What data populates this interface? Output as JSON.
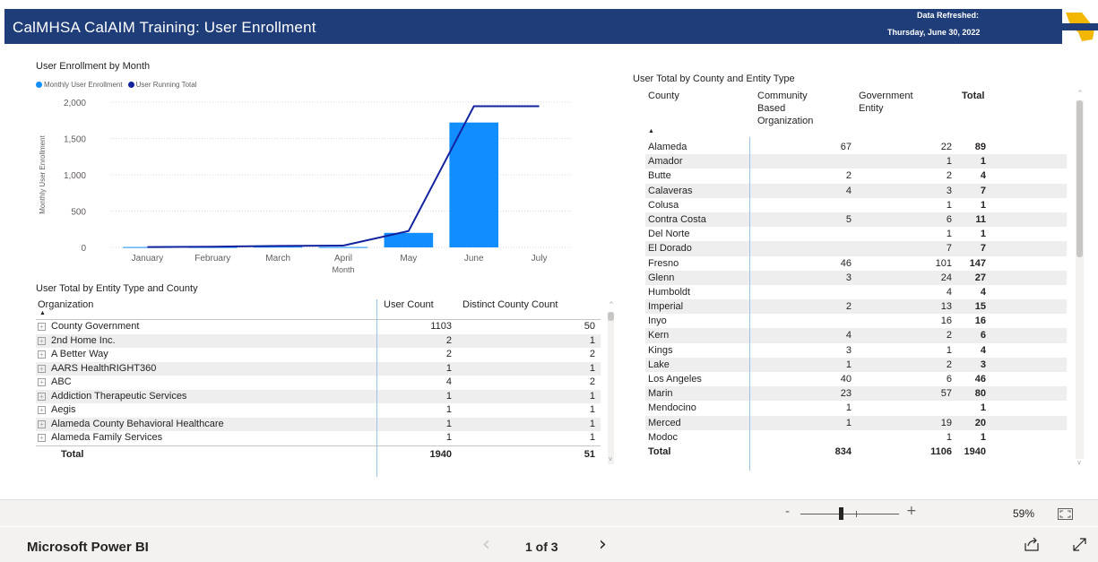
{
  "header": {
    "title": "CalMHSA CalAIM Training: User Enrollment",
    "refresh_label": "Data Refreshed:",
    "refresh_date": "Thursday, June 30, 2022"
  },
  "colors": {
    "header_bg": "#1f3d79",
    "bar": "#118dff",
    "line": "#12239e"
  },
  "chart_title": "User Enrollment by Month",
  "chart_data": {
    "type": "bar",
    "categories": [
      "January",
      "February",
      "March",
      "April",
      "May",
      "June",
      "July"
    ],
    "series": [
      {
        "name": "Monthly User Enrollment",
        "type": "bar",
        "values": [
          5,
          5,
          10,
          5,
          200,
          1720,
          0
        ]
      },
      {
        "name": "User Running Total",
        "type": "line",
        "values": [
          5,
          10,
          20,
          25,
          225,
          1945,
          1945
        ]
      }
    ],
    "xlabel": "Month",
    "ylabel": "Monthly User Enrollment",
    "ylim": [
      0,
      2000
    ],
    "yticks": [
      "0",
      "500",
      "1,000",
      "1,500",
      "2,000"
    ],
    "grid": true,
    "legend_position": "top-left"
  },
  "entity_table": {
    "title": "User Total by Entity Type and County",
    "headers": {
      "org": "Organization",
      "count": "User Count",
      "distinct": "Distinct County Count"
    },
    "rows": [
      {
        "org": "County Government",
        "count": "1103",
        "distinct": "50"
      },
      {
        "org": "2nd Home Inc.",
        "count": "2",
        "distinct": "1"
      },
      {
        "org": "A Better Way",
        "count": "2",
        "distinct": "2"
      },
      {
        "org": "AARS HealthRIGHT360",
        "count": "1",
        "distinct": "1"
      },
      {
        "org": "ABC",
        "count": "4",
        "distinct": "2"
      },
      {
        "org": "Addiction Therapeutic Services",
        "count": "1",
        "distinct": "1"
      },
      {
        "org": "Aegis",
        "count": "1",
        "distinct": "1"
      },
      {
        "org": "Alameda County Behavioral Healthcare",
        "count": "1",
        "distinct": "1"
      },
      {
        "org": "Alameda Family Services",
        "count": "1",
        "distinct": "1"
      }
    ],
    "total": {
      "label": "Total",
      "count": "1940",
      "distinct": "51"
    }
  },
  "county_table": {
    "title": "User Total by County and Entity Type",
    "headers": {
      "county": "County",
      "cbo": "Community\nBased\nOrganization",
      "gov": "Government\nEntity",
      "total": "Total"
    },
    "rows": [
      {
        "county": "Alameda",
        "cbo": "67",
        "gov": "22",
        "total": "89"
      },
      {
        "county": "Amador",
        "cbo": "",
        "gov": "1",
        "total": "1"
      },
      {
        "county": "Butte",
        "cbo": "2",
        "gov": "2",
        "total": "4"
      },
      {
        "county": "Calaveras",
        "cbo": "4",
        "gov": "3",
        "total": "7"
      },
      {
        "county": "Colusa",
        "cbo": "",
        "gov": "1",
        "total": "1"
      },
      {
        "county": "Contra Costa",
        "cbo": "5",
        "gov": "6",
        "total": "11"
      },
      {
        "county": "Del Norte",
        "cbo": "",
        "gov": "1",
        "total": "1"
      },
      {
        "county": "El Dorado",
        "cbo": "",
        "gov": "7",
        "total": "7"
      },
      {
        "county": "Fresno",
        "cbo": "46",
        "gov": "101",
        "total": "147"
      },
      {
        "county": "Glenn",
        "cbo": "3",
        "gov": "24",
        "total": "27"
      },
      {
        "county": "Humboldt",
        "cbo": "",
        "gov": "4",
        "total": "4"
      },
      {
        "county": "Imperial",
        "cbo": "2",
        "gov": "13",
        "total": "15"
      },
      {
        "county": "Inyo",
        "cbo": "",
        "gov": "16",
        "total": "16"
      },
      {
        "county": "Kern",
        "cbo": "4",
        "gov": "2",
        "total": "6"
      },
      {
        "county": "Kings",
        "cbo": "3",
        "gov": "1",
        "total": "4"
      },
      {
        "county": "Lake",
        "cbo": "1",
        "gov": "2",
        "total": "3"
      },
      {
        "county": "Los Angeles",
        "cbo": "40",
        "gov": "6",
        "total": "46"
      },
      {
        "county": "Marin",
        "cbo": "23",
        "gov": "57",
        "total": "80"
      },
      {
        "county": "Mendocino",
        "cbo": "1",
        "gov": "",
        "total": "1"
      },
      {
        "county": "Merced",
        "cbo": "1",
        "gov": "19",
        "total": "20"
      },
      {
        "county": "Modoc",
        "cbo": "",
        "gov": "1",
        "total": "1"
      }
    ],
    "total": {
      "label": "Total",
      "cbo": "834",
      "gov": "1106",
      "total": "1940"
    }
  },
  "zoom": {
    "minus": "-",
    "plus": "+",
    "percent": "59%"
  },
  "footer": {
    "brand": "Microsoft Power BI",
    "page": "1 of 3",
    "prev": "‹",
    "next": "›"
  }
}
